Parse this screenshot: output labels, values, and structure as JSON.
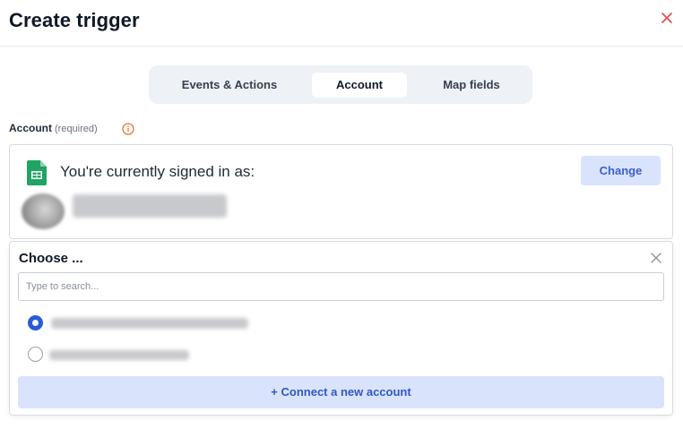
{
  "header": {
    "title": "Create trigger",
    "close_icon": "close-icon",
    "close_color": "#e04b4b"
  },
  "tabs": [
    {
      "label": "Events & Actions",
      "active": false
    },
    {
      "label": "Account",
      "active": true
    },
    {
      "label": "Map fields",
      "active": false
    }
  ],
  "account_field": {
    "label": "Account",
    "required_text": "(required)",
    "info_icon": "info-icon",
    "info_color": "#e8762d"
  },
  "signed_in": {
    "app_icon": "google-sheets-icon",
    "app_icon_color": "#1fa463",
    "text": "You're currently signed in as:",
    "change_label": "Change"
  },
  "chooser": {
    "title": "Choose ...",
    "close_icon": "close-icon",
    "search_placeholder": "Type to search...",
    "options": [
      {
        "selected": true
      },
      {
        "selected": false
      }
    ],
    "connect_label": "+ Connect a new account"
  },
  "colors": {
    "accent": "#2b5bd7",
    "button_bg": "#d9e3fb",
    "button_text": "#3b5fd0",
    "tab_bar_bg": "#eef1f6"
  }
}
